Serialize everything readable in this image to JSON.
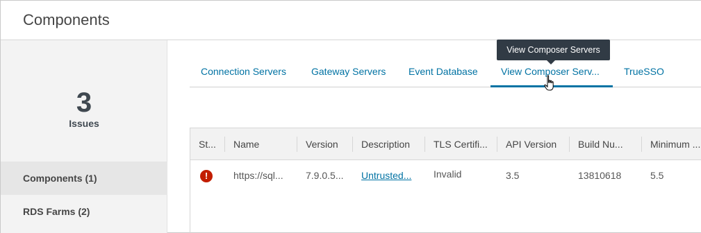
{
  "header": {
    "title": "Components"
  },
  "summary": {
    "count": "3",
    "label": "Issues"
  },
  "sidebar": {
    "items": [
      {
        "label": "Components (1)",
        "active": true
      },
      {
        "label": "RDS Farms (2)",
        "active": false
      }
    ]
  },
  "tabs": [
    {
      "label": "Connection Servers"
    },
    {
      "label": "Gateway Servers"
    },
    {
      "label": "Event Database"
    },
    {
      "label": "View Composer Serv...",
      "active": true
    },
    {
      "label": "TrueSSO"
    }
  ],
  "tooltip": {
    "text": "View Composer Servers"
  },
  "table": {
    "columns": [
      "St...",
      "Name",
      "Version",
      "Description",
      "TLS Certifi...",
      "API Version",
      "Build Nu...",
      "Minimum ..."
    ],
    "rows": [
      {
        "status_icon": "error-icon",
        "name": "https://sql...",
        "version": "7.9.0.5...",
        "description": "Untrusted...",
        "tls": "Invalid",
        "api_version": "3.5",
        "build": "13810618",
        "minimum": "5.5"
      }
    ]
  },
  "colors": {
    "accent": "#0072a3",
    "error": "#c21d00",
    "tooltip_bg": "#313b45"
  }
}
